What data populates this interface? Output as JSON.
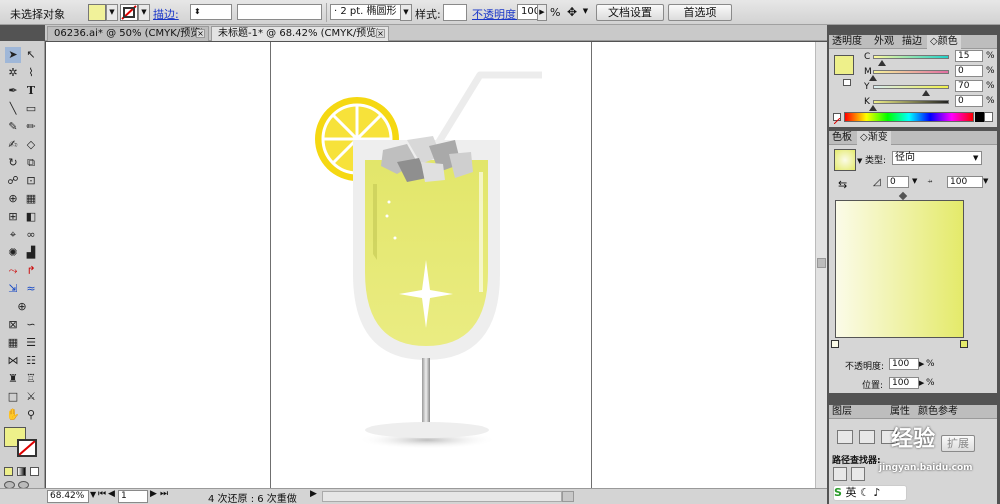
{
  "control_bar": {
    "no_selection": "未选择对象",
    "stroke_label": "描边:",
    "stroke_weight": "2 pt.",
    "brush_name": "椭圆形",
    "style_label": "样式:",
    "opacity_label": "不透明度:",
    "opacity_value": "100",
    "opacity_unit": "%",
    "doc_setup_button": "文档设置",
    "preferences_button": "首选项",
    "fill_color": "#f1f29a"
  },
  "tabs": [
    {
      "label": "06236.ai* @ 50% (CMYK/预览)"
    },
    {
      "label": "未标题-1* @ 68.42% (CMYK/预览)"
    }
  ],
  "status_bar": {
    "zoom": "68.42%",
    "artboard": "1",
    "history": "4 次还原 : 6 次重做"
  },
  "color_panel": {
    "tabs": [
      "透明度",
      "外观",
      "描边",
      "颜色"
    ],
    "channels": [
      {
        "label": "C",
        "value": "15"
      },
      {
        "label": "M",
        "value": "0"
      },
      {
        "label": "Y",
        "value": "70"
      },
      {
        "label": "K",
        "value": "0"
      }
    ],
    "swatch": "#eef08a"
  },
  "gradient_panel": {
    "tabs": [
      "色板",
      "渐变"
    ],
    "type_label": "类型:",
    "type_value": "径向",
    "angle_value": "0",
    "aspect_value": "100",
    "opacity_label": "不透明度:",
    "opacity_value": "100",
    "location_label": "位置:",
    "location_value": "100",
    "percent": "%",
    "start_color": "#fbfbe8",
    "end_color": "#e4ea6a"
  },
  "bottom_panel": {
    "tabs": [
      "图层",
      "属性",
      "颜色参考"
    ],
    "pathfinder_label": "路径查找器:",
    "expand_button": "扩展",
    "watermark": "经验",
    "watermark_url": "jingyan.baidu.com",
    "ime_label": "英"
  },
  "artwork": {
    "drink_color": "#e4e864",
    "lemon_color": "#f5d812",
    "glass_color": "#eeeeee"
  }
}
